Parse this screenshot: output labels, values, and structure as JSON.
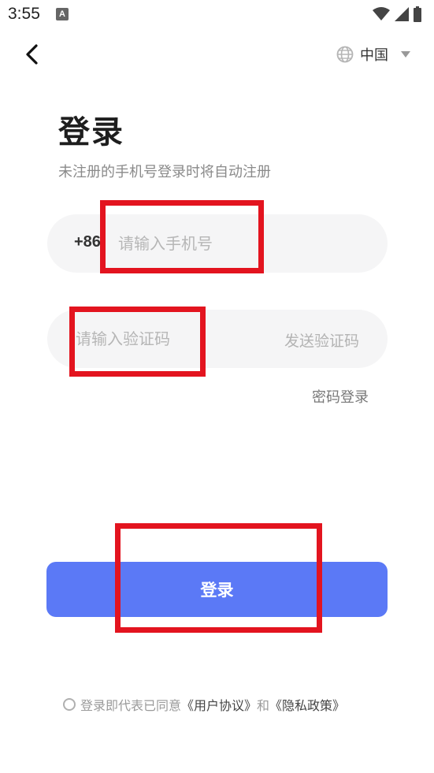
{
  "status_bar": {
    "time": "3:55",
    "app_icon_letter": "A"
  },
  "header": {
    "back_icon": "chevron-left-icon",
    "region_icon": "globe-icon",
    "region_label": "中国"
  },
  "title": "登录",
  "subtitle": "未注册的手机号登录时将自动注册",
  "phone_field": {
    "country_code": "+86",
    "placeholder": "请输入手机号",
    "value": ""
  },
  "code_field": {
    "placeholder": "请输入验证码",
    "value": "",
    "send_code_label": "发送验证码"
  },
  "password_login_label": "密码登录",
  "login_button_label": "登录",
  "agreement": {
    "prefix": "登录即代表已同意",
    "user_agreement": "《用户协议》",
    "conjunction": "和",
    "privacy_policy": "《隐私政策》"
  },
  "colors": {
    "primary": "#5b79f6",
    "highlight": "#e3141f",
    "field_bg": "#f5f5f6"
  }
}
